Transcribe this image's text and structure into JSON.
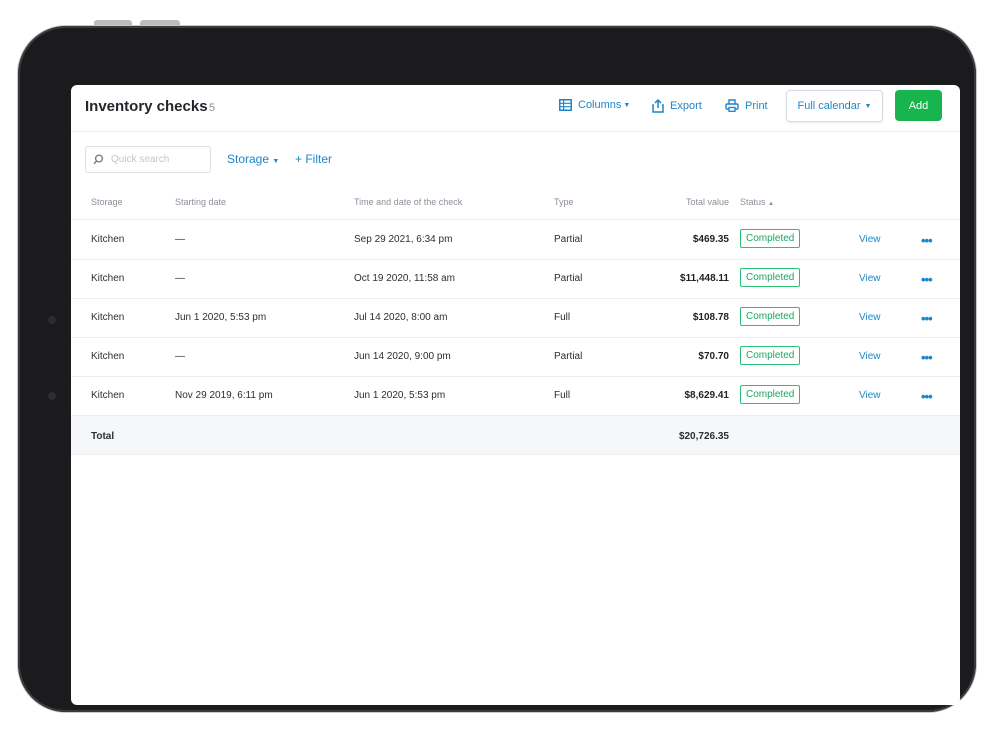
{
  "header": {
    "title": "Inventory checks",
    "count": "5",
    "columns_label": "Columns",
    "export_label": "Export",
    "print_label": "Print",
    "calendar_label": "Full calendar",
    "add_label": "Add"
  },
  "filters": {
    "search_placeholder": "Quick search",
    "storage_label": "Storage",
    "add_filter_label": "+ Filter"
  },
  "table": {
    "columns": [
      "Storage",
      "Starting date",
      "Time and date of the check",
      "Type",
      "Total value",
      "Status"
    ],
    "rows": [
      {
        "storage": "Kitchen",
        "start": "—",
        "check": "Sep 29 2021, 6:34 pm",
        "type": "Partial",
        "value": "$469.35",
        "status": "Completed",
        "action": "View"
      },
      {
        "storage": "Kitchen",
        "start": "—",
        "check": "Oct 19 2020, 11:58 am",
        "type": "Partial",
        "value": "$11,448.11",
        "status": "Completed",
        "action": "View"
      },
      {
        "storage": "Kitchen",
        "start": "Jun 1 2020, 5:53 pm",
        "check": "Jul 14 2020, 8:00 am",
        "type": "Full",
        "value": "$108.78",
        "status": "Completed",
        "action": "View"
      },
      {
        "storage": "Kitchen",
        "start": "—",
        "check": "Jun 14 2020, 9:00 pm",
        "type": "Partial",
        "value": "$70.70",
        "status": "Completed",
        "action": "View"
      },
      {
        "storage": "Kitchen",
        "start": "Nov 29 2019, 6:11 pm",
        "check": "Jun 1 2020, 5:53 pm",
        "type": "Full",
        "value": "$8,629.41",
        "status": "Completed",
        "action": "View"
      }
    ],
    "total_label": "Total",
    "total_value": "$20,726.35"
  },
  "colors": {
    "accent": "#1d86c8",
    "add_button": "#18b54f",
    "status_completed": "#19a862"
  },
  "icons": [
    "search-icon",
    "columns-icon",
    "export-icon",
    "print-icon",
    "more-icon"
  ]
}
